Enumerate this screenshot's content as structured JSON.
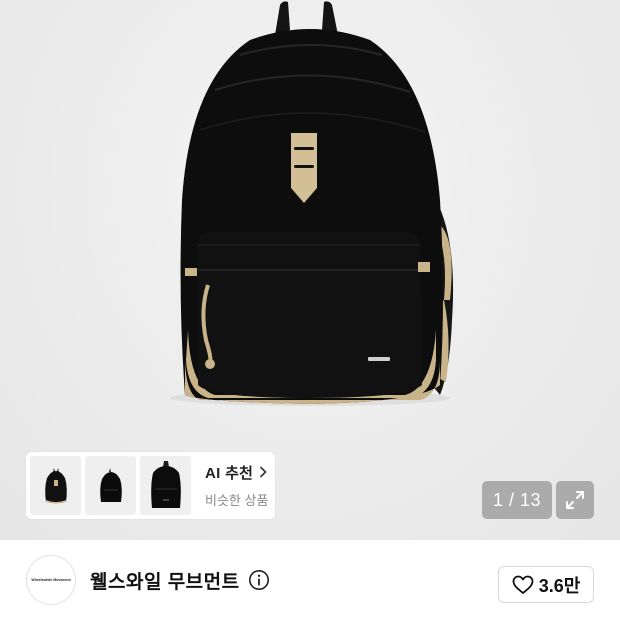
{
  "product": {
    "image_alt": "black backpack",
    "image_icon": "backpack-image"
  },
  "ai_recommend": {
    "title": "AI 추천",
    "subtitle": "비슷한 상품",
    "chevron_icon": "chevron-right-icon",
    "thumbnails": [
      "backpack-thumb-1",
      "backpack-thumb-2",
      "backpack-thumb-3"
    ]
  },
  "gallery": {
    "counter": "1 / 13",
    "expand_icon": "expand-icon"
  },
  "brand": {
    "logo_text": "Wheelswhile Movement",
    "name": "웰스와일 무브먼트",
    "info_icon": "info-icon"
  },
  "like": {
    "icon": "heart-icon",
    "count": "3.6만"
  },
  "colors": {
    "backpack": "#0d0d0d",
    "tan_accent": "#c9b48a",
    "counter_bg": "#a0a0a0"
  }
}
